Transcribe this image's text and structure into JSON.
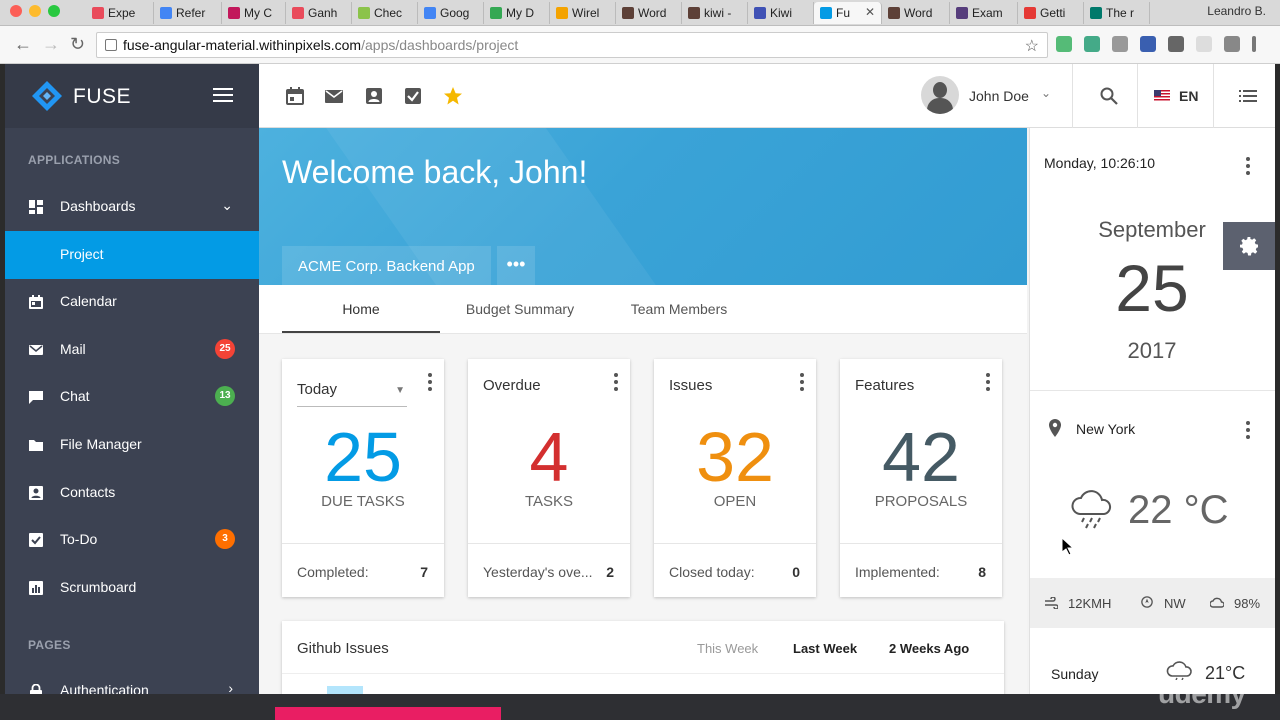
{
  "browser": {
    "tabs": [
      {
        "label": "Expe",
        "color": "#e94b5b"
      },
      {
        "label": "Refer",
        "color": "#4285f4"
      },
      {
        "label": "My C",
        "color": "#c2185b"
      },
      {
        "label": "Ganh",
        "color": "#e94b5b"
      },
      {
        "label": "Chec",
        "color": "#8bc34a"
      },
      {
        "label": "Goog",
        "color": "#4285f4"
      },
      {
        "label": "My D",
        "color": "#34a853"
      },
      {
        "label": "Wirel",
        "color": "#f4a300"
      },
      {
        "label": "Word",
        "color": "#5d4037"
      },
      {
        "label": "kiwi -",
        "color": "#5d4037"
      },
      {
        "label": "Kiwi",
        "color": "#3f51b5"
      },
      {
        "label": "Fu",
        "color": "#039be5"
      },
      {
        "label": "Word",
        "color": "#5d4037"
      },
      {
        "label": "Exam",
        "color": "#563d7c"
      },
      {
        "label": "Getti",
        "color": "#e53935"
      },
      {
        "label": "The r",
        "color": "#00796b"
      }
    ],
    "active_close": "✕",
    "profile": "Leandro B.",
    "url_host": "fuse-angular-material.withinpixels.com",
    "url_path": "/apps/dashboards/project"
  },
  "sidebar": {
    "brand": "FUSE",
    "section_applications": "APPLICATIONS",
    "section_pages": "PAGES",
    "items": [
      {
        "label": "Dashboards",
        "icon": "dashboard-icon"
      },
      {
        "label": "Project",
        "icon": ""
      },
      {
        "label": "Calendar",
        "icon": "calendar-icon"
      },
      {
        "label": "Mail",
        "icon": "mail-icon",
        "badge": "25",
        "badge_color": "#f44336"
      },
      {
        "label": "Chat",
        "icon": "chat-icon",
        "badge": "13",
        "badge_color": "#4caf50"
      },
      {
        "label": "File Manager",
        "icon": "folder-icon"
      },
      {
        "label": "Contacts",
        "icon": "contacts-icon"
      },
      {
        "label": "To-Do",
        "icon": "todo-icon",
        "badge": "3",
        "badge_color": "#ff6f00"
      },
      {
        "label": "Scrumboard",
        "icon": "scrumboard-icon"
      },
      {
        "label": "Authentication",
        "icon": "lock-icon"
      }
    ]
  },
  "topbar": {
    "user_name": "John Doe",
    "language": "EN",
    "shortcut_star_color": "#f5b800"
  },
  "hero": {
    "title": "Welcome back, John!",
    "project": "ACME Corp. Backend App",
    "more": "•••"
  },
  "tabs": [
    "Home",
    "Budget Summary",
    "Team Members"
  ],
  "cards": [
    {
      "title": "Today",
      "value": "25",
      "unit": "DUE TASKS",
      "footer_label": "Completed:",
      "footer_value": "7",
      "color": "#039be5"
    },
    {
      "title": "Overdue",
      "value": "4",
      "unit": "TASKS",
      "footer_label": "Yesterday's ove...",
      "footer_value": "2",
      "color": "#d32f2f"
    },
    {
      "title": "Issues",
      "value": "32",
      "unit": "OPEN",
      "footer_label": "Closed today:",
      "footer_value": "0",
      "color": "#ef8f0f"
    },
    {
      "title": "Features",
      "value": "42",
      "unit": "PROPOSALS",
      "footer_label": "Implemented:",
      "footer_value": "8",
      "color": "#455a64"
    }
  ],
  "github": {
    "title": "Github Issues",
    "ranges": [
      "This Week",
      "Last Week",
      "2 Weeks Ago"
    ]
  },
  "right_panel": {
    "datetime": "Monday, 10:26:10",
    "month": "September",
    "day": "25",
    "year": "2017",
    "city": "New York",
    "temperature": "22 °C",
    "wind_speed": "12KMH",
    "wind_dir": "NW",
    "humidity": "98%",
    "forecast_day": "Sunday",
    "forecast_temp": "21°C"
  },
  "watermark": "udemy"
}
